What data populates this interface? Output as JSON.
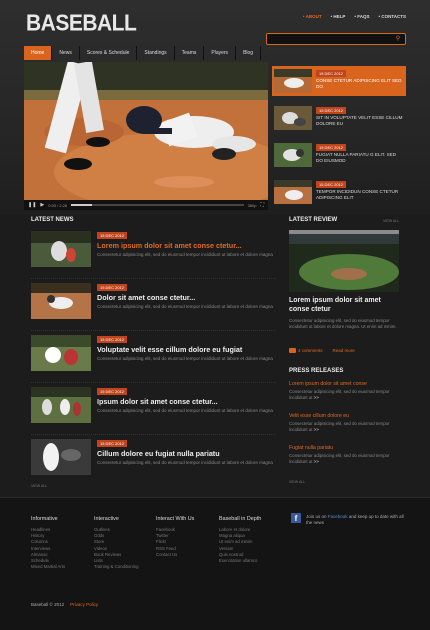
{
  "brand": {
    "logo": "BASEBALL"
  },
  "topnav": [
    "• ABOUT",
    "• HELP",
    "• FAQS",
    "• CONTACTS"
  ],
  "search": {
    "placeholder": ""
  },
  "mainnav": [
    "Home",
    "News",
    "Scores & Schedule",
    "Standings",
    "Teams",
    "Players",
    "Blog"
  ],
  "player": {
    "time": "0:03 / 2:26",
    "quality": "360p"
  },
  "slider": [
    {
      "date": "15 DEC 2012",
      "text": "CONSE CTETUR ADIPISCING ELIT SED DO"
    },
    {
      "date": "15 DEC 2012",
      "text": "SIT IN VOLUPTATE VELIT ESSE CILLUM DOLORE EU"
    },
    {
      "date": "15 DEC 2012",
      "text": "FUGIAT NULLA PARIATU G ELIT. SED DO EIUSMOD"
    },
    {
      "date": "15 DEC 2012",
      "text": "TEMPOR INCIDIDUN CONSE CTETUR ADIPISCING ELIT"
    }
  ],
  "latest_news": {
    "heading": "LATEST NEWS",
    "view_all": "VIEW ALL",
    "items": [
      {
        "date": "15 DEC 2012",
        "title": "Lorem ipsum dolor sit amet conse ctetur...",
        "desc": "Consectetur adipisicing elit, sed do eiusmod tempor incididunt ut labore et dolore magna"
      },
      {
        "date": "15 DEC 2012",
        "title": "Dolor sit amet conse ctetur...",
        "desc": "Consectetur adipisicing elit, sed do eiusmod tempor incididunt ut labore et dolore magna"
      },
      {
        "date": "15 DEC 2012",
        "title": "Voluptate velit esse cillum dolore eu fugiat",
        "desc": "Consectetur adipisicing elit, sed do eiusmod tempor incididunt ut labore et dolore magna"
      },
      {
        "date": "15 DEC 2012",
        "title": "Ipsum dolor sit amet conse ctetur...",
        "desc": "Consectetur adipisicing elit, sed do eiusmod tempor incididunt ut labore et dolore magna"
      },
      {
        "date": "15 DEC 2012",
        "title": "Cillum dolore eu fugiat nulla pariatu",
        "desc": "Consectetur adipisicing elit, sed do eiusmod tempor incididunt ut labore et dolore magna"
      }
    ]
  },
  "latest_review": {
    "heading": "LATEST REVIEW",
    "view_all": "VIEW ALL",
    "title": "Lorem ipsum dolor sit amet conse ctetur",
    "desc": "Consectetur adipisicing elit, sed do eiusmod tempor incididunt ut labore et dolore magna. Ut enim ad minim.",
    "comments": "4 comments",
    "more": "Read more"
  },
  "press": {
    "heading": "PRESS RELEASES",
    "view_all": "VIEW ALL",
    "items": [
      {
        "title": "Lorem ipsum dolor sit amet conse",
        "desc": "Consectetur adipisicing elit, sed do eiusmod tempor incididunt ut",
        "more": ">>"
      },
      {
        "title": "Velit esse cillum dolore eu",
        "desc": "Consectetur adipisicing elit, sed do eiusmod tempor incididunt ut",
        "more": ">>"
      },
      {
        "title": "Fugiat nulla pariatu",
        "desc": "Consectetur adipisicing elit, sed do eiusmod tempor incididunt ut",
        "more": ">>"
      }
    ]
  },
  "footer": {
    "cols": [
      {
        "heading": "Informative",
        "links": [
          "Headlines",
          "History",
          "Columns",
          "Interviews",
          "Almanac",
          "Schedule",
          "Mixed Martial Arts"
        ]
      },
      {
        "heading": "Interactive",
        "links": [
          "Outlines",
          "Odds",
          "Store",
          "Videos",
          "Book Reviews",
          "Lists",
          "Training & Conditioning"
        ]
      },
      {
        "heading": "Interact With Us",
        "links": [
          "Facebook",
          "Twitter",
          "Flickr",
          "RSS Feed",
          "Contact Us"
        ]
      },
      {
        "heading": "Baseball in Depth",
        "links": [
          "Labore et dolore",
          "Magna aliqua",
          "Ut enim ad minim",
          "Veniam",
          "Quis nostrud",
          "Exercitation ullamco"
        ]
      }
    ],
    "facebook_text_pre": "Join us on",
    "facebook_link": "Facebook",
    "facebook_text_post": "and keep up to date with all the news",
    "copyright": "Baseball © 2012",
    "privacy": "Privacy Policy"
  },
  "colors": {
    "accent": "#d8641e",
    "date_badge": "#c0441c",
    "bg": "#1c1c1c"
  }
}
